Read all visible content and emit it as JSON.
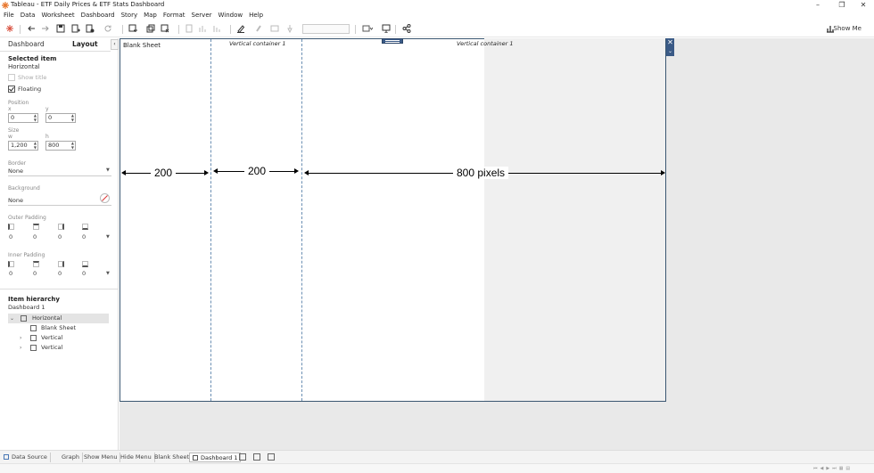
{
  "window": {
    "title": "Tableau - ETF Daily Prices & ETF Stats Dashboard",
    "minimize": "–",
    "restore": "❐",
    "close": "✕"
  },
  "menu": [
    "File",
    "Data",
    "Worksheet",
    "Dashboard",
    "Story",
    "Map",
    "Format",
    "Server",
    "Window",
    "Help"
  ],
  "toolbar": {
    "show_me": "Show Me"
  },
  "left_pane": {
    "tabs": [
      "Dashboard",
      "Layout"
    ],
    "collapse_glyph": "‹",
    "selected_item_heading": "Selected item",
    "selected_item_value": "Horizontal",
    "show_title_label": "Show title",
    "floating_label": "Floating",
    "floating_checked": true,
    "position_label": "Position",
    "x_label": "x",
    "x_value": "0",
    "y_label": "y",
    "y_value": "0",
    "size_label": "Size",
    "w_label": "w",
    "w_value": "1,200",
    "h_label": "h",
    "h_value": "800",
    "border_label": "Border",
    "border_value": "None",
    "background_label": "Background",
    "background_value": "None",
    "outer_padding_label": "Outer Padding",
    "outer_padding": [
      "0",
      "0",
      "0",
      "0"
    ],
    "inner_padding_label": "Inner Padding",
    "inner_padding": [
      "0",
      "0",
      "0",
      "0"
    ],
    "hierarchy_heading": "Item hierarchy",
    "hierarchy_root": "Dashboard 1",
    "hierarchy": [
      {
        "label": "Horizontal",
        "level": 1,
        "expander": "⌄"
      },
      {
        "label": "Blank Sheet",
        "level": 2,
        "expander": ""
      },
      {
        "label": "Vertical",
        "level": 2,
        "expander": "›"
      },
      {
        "label": "Vertical",
        "level": 2,
        "expander": "›"
      }
    ]
  },
  "canvas": {
    "blank_sheet_title": "Blank Sheet",
    "vertical_container_1": "Vertical container 1",
    "vertical_container_2": "Vertical container 1",
    "close_glyph": "✕",
    "more_glyph": "⌄",
    "annotations": {
      "dim1": "200",
      "dim2": "200",
      "dim3": "800 pixels"
    }
  },
  "sheet_tabs": [
    "Data Source",
    "Graph",
    "Show Menu",
    "Hide Menu",
    "Blank Sheet",
    "Dashboard 1"
  ],
  "active_sheet_tab": "Dashboard 1",
  "colors": {
    "dashboard_border": "#3b5772",
    "container_handle": "#3a5a86",
    "tableau_logo": "#e8762c"
  }
}
